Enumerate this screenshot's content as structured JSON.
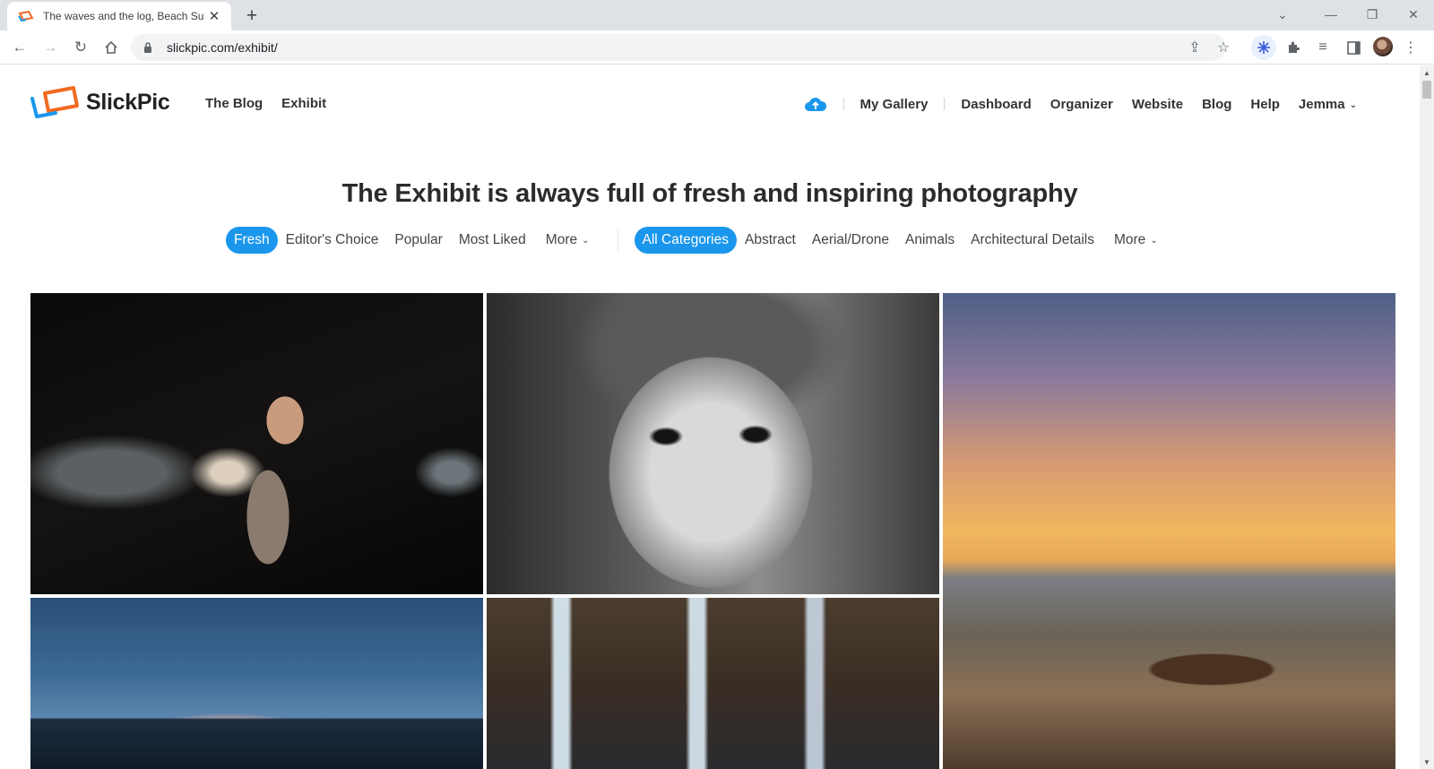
{
  "browser": {
    "tab_title": "The waves and the log, Beach Su",
    "new_tab_icon": "+",
    "url": "slickpic.com/exhibit/",
    "window_controls": [
      "minimize",
      "restore",
      "close"
    ]
  },
  "site": {
    "brand": "SlickPic",
    "brand_colors": {
      "orange": "#f26a21",
      "blue": "#1a96ec"
    },
    "nav_left": [
      "The Blog",
      "Exhibit"
    ],
    "nav_right": {
      "gallery": "My Gallery",
      "items": [
        "Dashboard",
        "Organizer",
        "Website",
        "Blog",
        "Help"
      ],
      "user": "Jemma"
    }
  },
  "main": {
    "headline": "The Exhibit is always full of fresh and inspiring photography",
    "sort_filters": {
      "active": "Fresh",
      "items": [
        "Editor's Choice",
        "Popular",
        "Most Liked"
      ],
      "more": "More"
    },
    "category_filters": {
      "active": "All Categories",
      "items": [
        "Abstract",
        "Aerial/Drone",
        "Animals",
        "Architectural Details"
      ],
      "more": "More"
    },
    "photos": [
      {
        "subject": "woman with sparklers at night"
      },
      {
        "subject": "black and white portrait of a child"
      },
      {
        "subject": "the waves and the log, beach sunset"
      },
      {
        "subject": "mountains under stormy blue sky"
      },
      {
        "subject": "waterfall over dark rocks"
      }
    ]
  }
}
